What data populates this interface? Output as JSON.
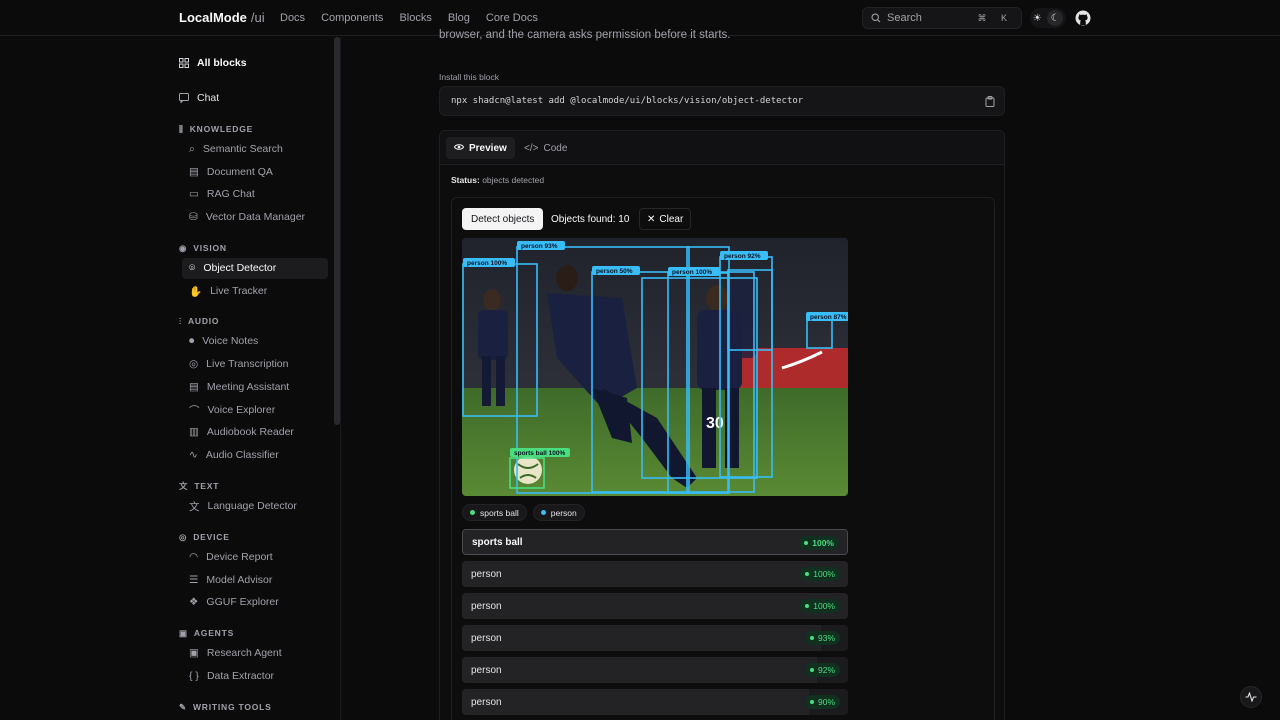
{
  "header": {
    "brand": "LocalMode",
    "brand_sub": "/ui",
    "nav": [
      "Docs",
      "Components",
      "Blocks",
      "Blog",
      "Core Docs"
    ],
    "search_label": "Search",
    "search_kbd": "⌘ K"
  },
  "sidebar": {
    "all_blocks": "All blocks",
    "chat": "Chat",
    "sections": {
      "knowledge": {
        "title": "KNOWLEDGE",
        "items": [
          "Semantic Search",
          "Document QA",
          "RAG Chat",
          "Vector Data Manager"
        ]
      },
      "vision": {
        "title": "VISION",
        "items": [
          "Object Detector",
          "Live Tracker"
        ]
      },
      "audio": {
        "title": "AUDIO",
        "items": [
          "Voice Notes",
          "Live Transcription",
          "Meeting Assistant",
          "Voice Explorer",
          "Audiobook Reader",
          "Audio Classifier"
        ]
      },
      "text": {
        "title": "TEXT",
        "items": [
          "Language Detector"
        ]
      },
      "device": {
        "title": "DEVICE",
        "items": [
          "Device Report",
          "Model Advisor",
          "GGUF Explorer"
        ]
      },
      "agents": {
        "title": "AGENTS",
        "items": [
          "Research Agent",
          "Data Extractor"
        ]
      },
      "writing": {
        "title": "WRITING TOOLS"
      }
    },
    "active": "Object Detector"
  },
  "main": {
    "intro": "browser, and the camera asks permission before it starts.",
    "install_label": "Install this block",
    "install_cmd": "npx shadcn@latest add @localmode/ui/blocks/vision/object-detector",
    "tabs": [
      "Preview",
      "Code"
    ],
    "status_label": "Status:",
    "status_value": "objects detected",
    "detect_button": "Detect objects",
    "objects_found": "Objects found: 10",
    "clear_button": "Clear",
    "boxes": [
      {
        "label": "person 100%",
        "color": "#38bdf8"
      },
      {
        "label": "person 93%",
        "color": "#38bdf8"
      },
      {
        "label": "person 50%",
        "color": "#38bdf8"
      },
      {
        "label": "person 100%",
        "color": "#38bdf8"
      },
      {
        "label": "person 92%",
        "color": "#38bdf8"
      },
      {
        "label": "person 87%",
        "color": "#38bdf8"
      },
      {
        "label": "sports ball 100%",
        "color": "#4ade80"
      }
    ],
    "legend": [
      {
        "label": "sports ball",
        "color": "#4ade80"
      },
      {
        "label": "person",
        "color": "#38bdf8"
      }
    ],
    "detections": [
      {
        "label": "sports ball",
        "score": "100%",
        "fill": 1.0
      },
      {
        "label": "person",
        "score": "100%",
        "fill": 1.0
      },
      {
        "label": "person",
        "score": "100%",
        "fill": 1.0
      },
      {
        "label": "person",
        "score": "93%",
        "fill": 0.93
      },
      {
        "label": "person",
        "score": "92%",
        "fill": 0.92
      },
      {
        "label": "person",
        "score": "90%",
        "fill": 0.9
      }
    ]
  }
}
